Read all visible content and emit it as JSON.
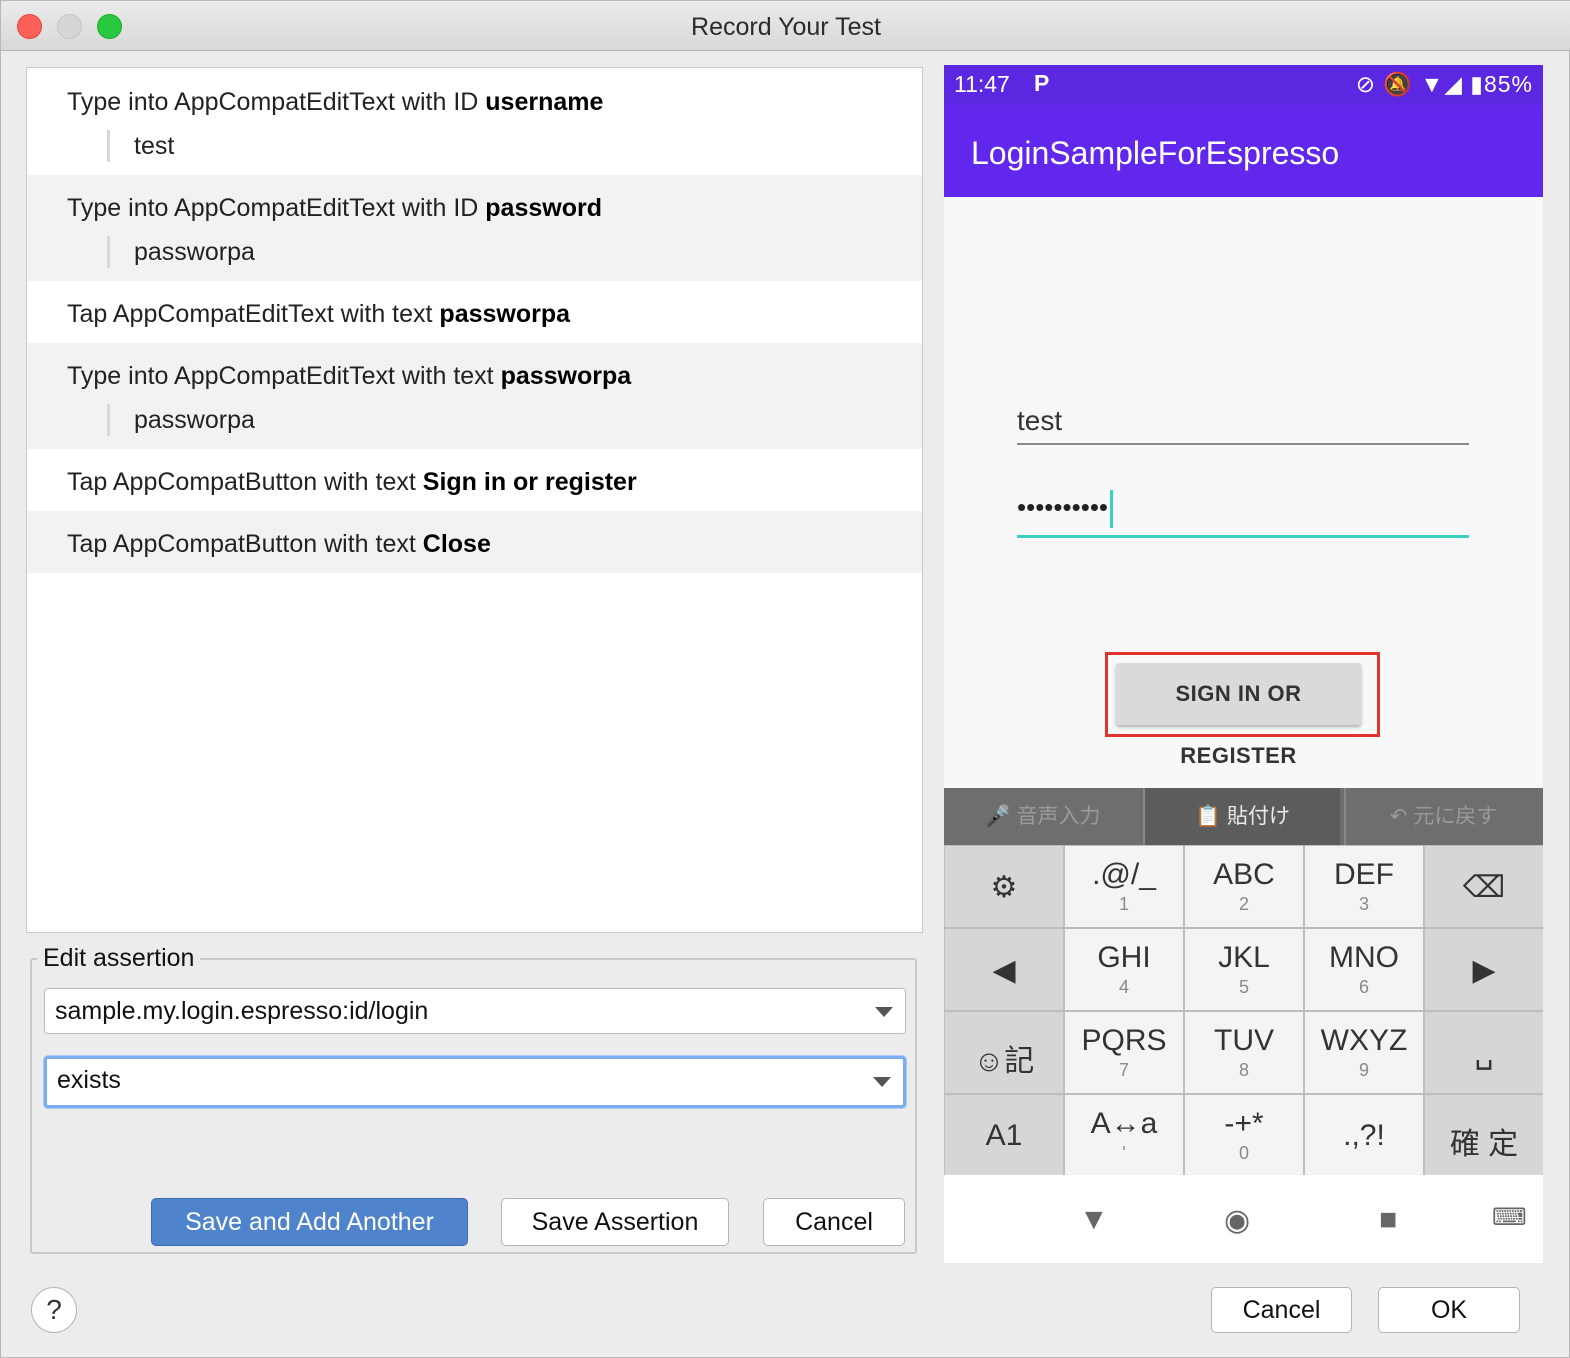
{
  "window": {
    "title": "Record Your Test"
  },
  "steps": [
    {
      "action": "Type into AppCompatEditText with ID ",
      "target": "username",
      "value": "test"
    },
    {
      "action": "Type into AppCompatEditText with ID ",
      "target": "password",
      "value": "passworpa"
    },
    {
      "action": "Tap AppCompatEditText with text ",
      "target": "passworpa"
    },
    {
      "action": "Type into AppCompatEditText with text ",
      "target": "passworpa",
      "value": "passworpa"
    },
    {
      "action": "Tap AppCompatButton with text ",
      "target": "Sign in or register"
    },
    {
      "action": "Tap AppCompatButton with text ",
      "target": "Close"
    }
  ],
  "assertion": {
    "legend": "Edit assertion",
    "view_selector": "sample.my.login.espresso:id/login",
    "condition": "exists",
    "save_and_add": "Save and Add Another",
    "save": "Save Assertion",
    "cancel": "Cancel"
  },
  "dialog": {
    "help": "?",
    "cancel": "Cancel",
    "ok": "OK"
  },
  "phone": {
    "status": {
      "time": "11:47",
      "p": "P",
      "right": "⊘ 🔕 ▼◢ ▮85%"
    },
    "app_title": "LoginSampleForEspresso",
    "username_value": "test",
    "password_value": "••••••••••",
    "signin_label": "SIGN IN OR REGISTER",
    "toolbar": {
      "voice": "🎤 音声入力",
      "paste": "📋 貼付け",
      "undo": "↶ 元に戻す"
    },
    "keys": [
      {
        "main": "⚙",
        "num": "",
        "dark": true
      },
      {
        "main": ".@/_",
        "num": "1"
      },
      {
        "main": "ABC",
        "num": "2"
      },
      {
        "main": "DEF",
        "num": "3"
      },
      {
        "main": "⌫",
        "num": "",
        "dark": true
      },
      {
        "main": "◀",
        "num": "",
        "dark": true
      },
      {
        "main": "GHI",
        "num": "4"
      },
      {
        "main": "JKL",
        "num": "5"
      },
      {
        "main": "MNO",
        "num": "6"
      },
      {
        "main": "▶",
        "num": "",
        "dark": true
      },
      {
        "main": "☺記",
        "num": "",
        "dark": true
      },
      {
        "main": "PQRS",
        "num": "7"
      },
      {
        "main": "TUV",
        "num": "8"
      },
      {
        "main": "WXYZ",
        "num": "9"
      },
      {
        "main": "␣",
        "num": "",
        "dark": true
      },
      {
        "main": "A1",
        "num": "",
        "dark": true
      },
      {
        "main": "A↔a",
        "num": "'"
      },
      {
        "main": "-+*",
        "num": "0"
      },
      {
        "main": ".,?!",
        "num": ""
      },
      {
        "main": "確 定",
        "num": "",
        "dark": true
      }
    ],
    "nav": {
      "back": "▼",
      "home": "◉",
      "recents": "■",
      "keyboard": "⌨"
    }
  }
}
